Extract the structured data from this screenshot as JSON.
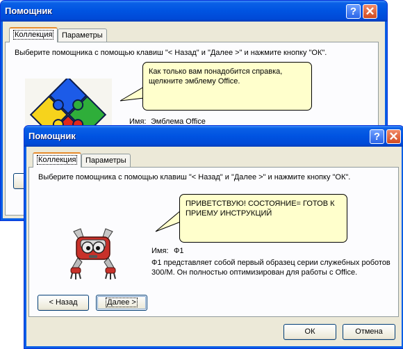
{
  "colors": {
    "titlebar": "#0054e3",
    "bubble": "#ffffcc",
    "dialog_bg": "#ece9d8"
  },
  "icons": {
    "help": "help-icon",
    "close": "close-icon"
  },
  "back_dialog": {
    "title": "Помощник",
    "help_glyph": "?",
    "close_glyph": "✕",
    "tabs": [
      "Коллекция",
      "Параметры"
    ],
    "instruction": "Выберите помощника с помощью клавиш \"< Назад\" и \"Далее >\" и нажмите кнопку \"ОК\".",
    "bubble_line1": "Как только вам понадобится справка,",
    "bubble_line2": "щелкните эмблему Office.",
    "name_label": "Имя:",
    "name_value": "Эмблема Office"
  },
  "front_dialog": {
    "title": "Помощник",
    "help_glyph": "?",
    "close_glyph": "✕",
    "tabs": [
      "Коллекция",
      "Параметры"
    ],
    "instruction": "Выберите помощника с помощью клавиш \"< Назад\" и \"Далее >\" и нажмите кнопку \"ОК\".",
    "bubble_line1": "ПРИВЕТСТВУЮ! СОСТОЯНИЕ= ГОТОВ К",
    "bubble_line2": "ПРИЕМУ ИНСТРУКЦИЙ",
    "name_label": "Имя:",
    "name_value": "Ф1",
    "description_line1": "Ф1 представляет собой первый образец серии служебных роботов",
    "description_line2": "300/M. Он полностью оптимизирован для работы с Office.",
    "back_label": "< Назад",
    "next_label": "Далее >",
    "ok_label": "ОК",
    "cancel_label": "Отмена"
  }
}
